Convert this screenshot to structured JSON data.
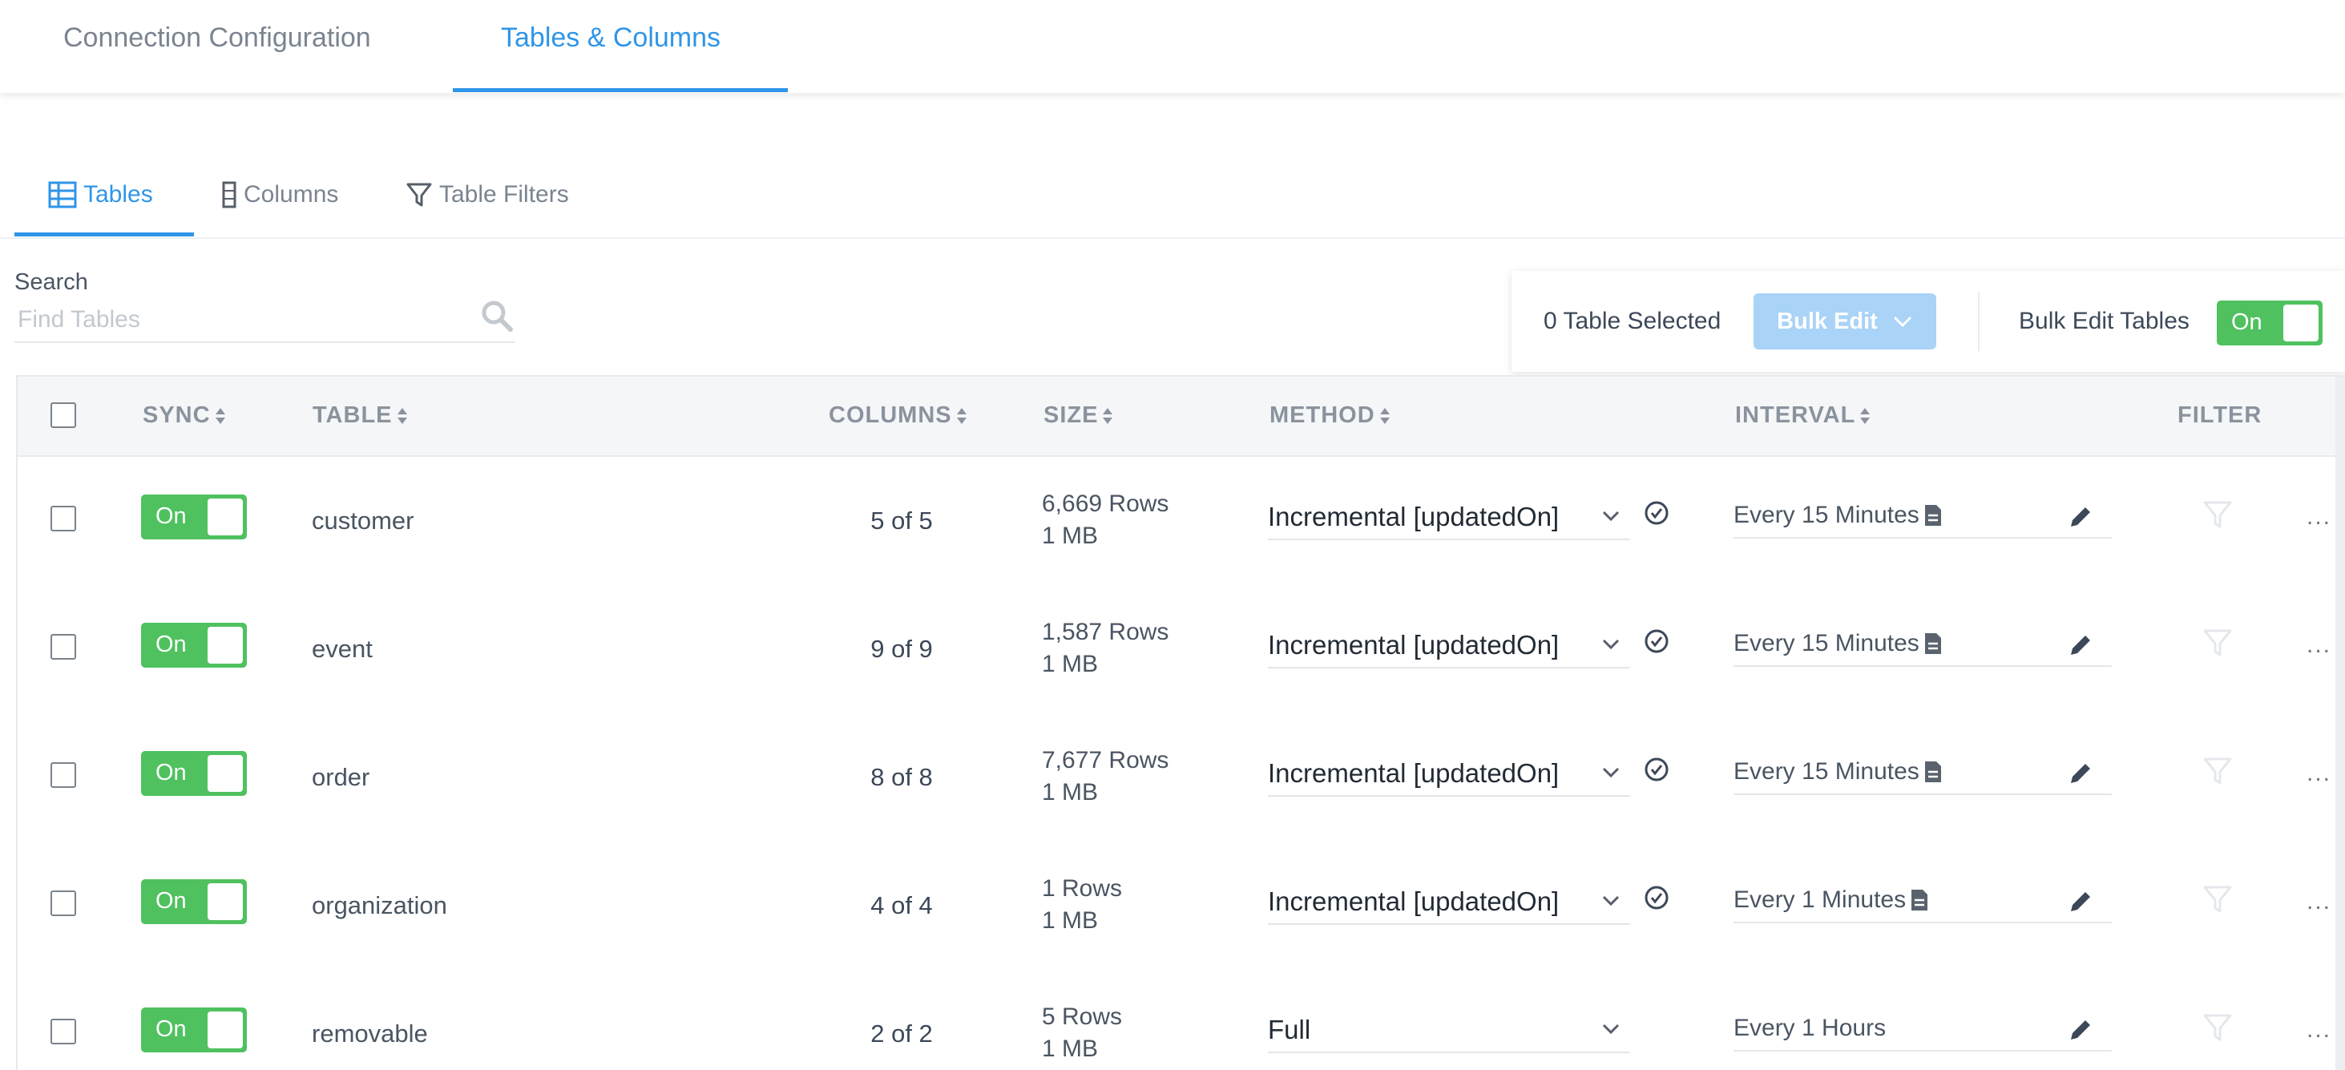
{
  "top_tabs": [
    {
      "label": "Connection Configuration",
      "active": false
    },
    {
      "label": "Tables & Columns",
      "active": true
    }
  ],
  "sub_tabs": [
    {
      "label": "Tables",
      "icon": "table-icon",
      "active": true
    },
    {
      "label": "Columns",
      "icon": "column-icon",
      "active": false
    },
    {
      "label": "Table Filters",
      "icon": "filter-icon",
      "active": false
    }
  ],
  "search": {
    "label": "Search",
    "placeholder": "Find Tables",
    "value": ""
  },
  "bulk": {
    "selected_text": "0 Table Selected",
    "edit_button": "Bulk Edit",
    "toggle_label": "Bulk Edit Tables",
    "toggle_state": "On"
  },
  "table": {
    "headers": {
      "sync": "SYNC",
      "table": "TABLE",
      "columns": "COLUMNS",
      "size": "SIZE",
      "method": "METHOD",
      "interval": "INTERVAL",
      "filter": "FILTER"
    },
    "rows": [
      {
        "sync": "On",
        "table": "customer",
        "columns": "5 of 5",
        "rows": "6,669 Rows",
        "size": "1 MB",
        "method": "Incremental  [updatedOn]",
        "verified": true,
        "interval": "Every 15 Minutes",
        "interval_note": true
      },
      {
        "sync": "On",
        "table": "event",
        "columns": "9 of 9",
        "rows": "1,587 Rows",
        "size": "1 MB",
        "method": "Incremental  [updatedOn]",
        "verified": true,
        "interval": "Every 15 Minutes",
        "interval_note": true
      },
      {
        "sync": "On",
        "table": "order",
        "columns": "8 of 8",
        "rows": "7,677 Rows",
        "size": "1 MB",
        "method": "Incremental  [updatedOn]",
        "verified": true,
        "interval": "Every 15 Minutes",
        "interval_note": true
      },
      {
        "sync": "On",
        "table": "organization",
        "columns": "4 of 4",
        "rows": "1 Rows",
        "size": "1 MB",
        "method": "Incremental  [updatedOn]",
        "verified": true,
        "interval": "Every 1 Minutes",
        "interval_note": true
      },
      {
        "sync": "On",
        "table": "removable",
        "columns": "2 of 2",
        "rows": "5 Rows",
        "size": "1 MB",
        "method": "Full",
        "verified": false,
        "interval": "Every 1 Hours",
        "interval_note": false
      }
    ],
    "more_label": "..."
  },
  "colors": {
    "accent": "#2f95e8",
    "toggle_on": "#4fc15f",
    "bulk_button": "#a9d3f7"
  }
}
